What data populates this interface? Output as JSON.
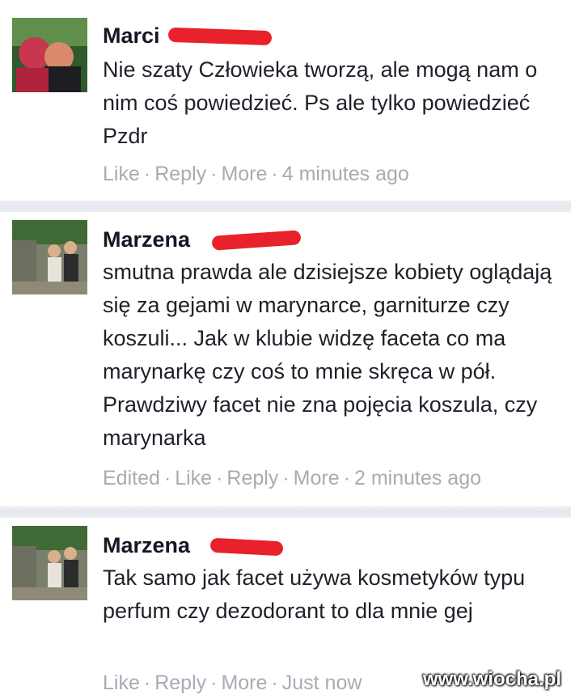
{
  "comments": [
    {
      "author": "Marci",
      "text": "Nie szaty Człowieka tworzą, ale mogą nam o nim coś powiedzieć. Ps ale tylko powiedzieć Pzdr",
      "actions": {
        "edited": "",
        "like": "Like",
        "reply": "Reply",
        "more": "More",
        "time": "4 minutes ago"
      }
    },
    {
      "author": "Marzena",
      "text": "smutna prawda ale dzisiejsze kobiety oglądają się za gejami w marynarce, garniturze czy koszuli... Jak w klubie widzę faceta co ma marynarkę czy coś to mnie skręca w pół. Prawdziwy facet nie zna pojęcia koszula, czy marynarka",
      "actions": {
        "edited": "Edited",
        "like": "Like",
        "reply": "Reply",
        "more": "More",
        "time": "2 minutes ago"
      }
    },
    {
      "author": "Marzena",
      "text": "Tak samo jak facet używa kosmetyków typu perfum czy dezodorant to dla mnie gej",
      "actions": {
        "edited": "",
        "like": "Like",
        "reply": "Reply",
        "more": "More",
        "time": "Just now"
      }
    }
  ],
  "separator": "·",
  "watermark": "www.wiocha.pl",
  "colors": {
    "author": "#141823",
    "text": "#1d2129",
    "meta": "#a7acb4",
    "redaction": "#e8212a"
  }
}
